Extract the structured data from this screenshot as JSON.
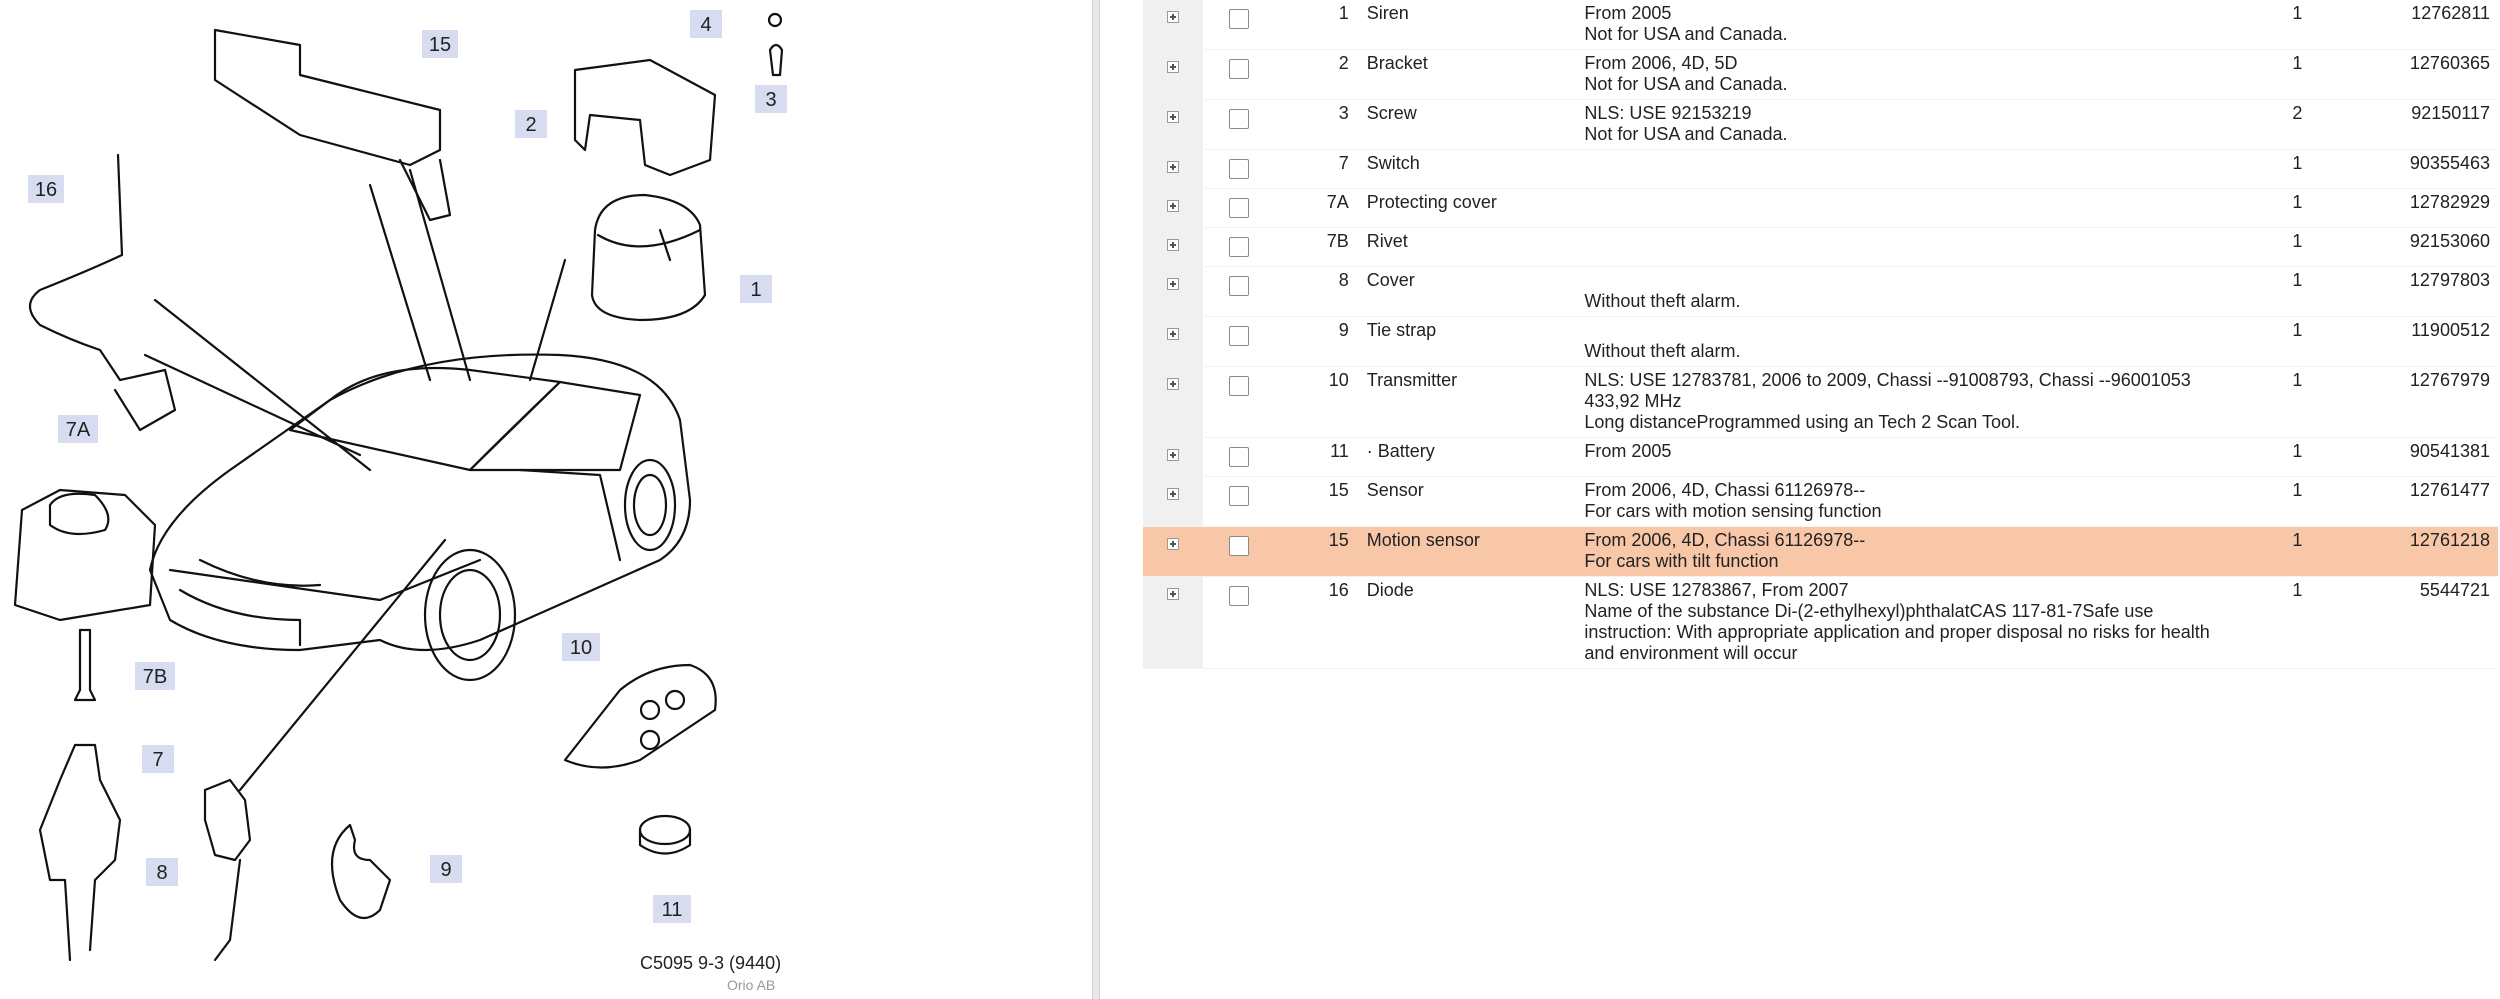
{
  "diagram": {
    "code": "C5095 9-3 (9440)",
    "copyright": "Orio AB",
    "callouts": [
      "15",
      "4",
      "3",
      "2",
      "1",
      "16",
      "7A",
      "7B",
      "7",
      "8",
      "9",
      "10",
      "11"
    ]
  },
  "parts": [
    {
      "pos": "1",
      "name": "Siren",
      "remark": [
        "From 2005",
        "Not for USA and Canada."
      ],
      "qty": "1",
      "partno": "12762811",
      "highlight": false
    },
    {
      "pos": "2",
      "name": "Bracket",
      "remark": [
        "From 2006, 4D, 5D",
        "Not for USA and Canada."
      ],
      "qty": "1",
      "partno": "12760365",
      "highlight": false
    },
    {
      "pos": "3",
      "name": "Screw",
      "remark": [
        "NLS: USE 92153219",
        "Not for USA and Canada."
      ],
      "qty": "2",
      "partno": "92150117",
      "highlight": false
    },
    {
      "pos": "7",
      "name": "Switch",
      "remark": [],
      "qty": "1",
      "partno": "90355463",
      "highlight": false
    },
    {
      "pos": "7A",
      "name": "Protecting cover",
      "remark": [],
      "qty": "1",
      "partno": "12782929",
      "highlight": false
    },
    {
      "pos": "7B",
      "name": "Rivet",
      "remark": [],
      "qty": "1",
      "partno": "92153060",
      "highlight": false
    },
    {
      "pos": "8",
      "name": "Cover",
      "remark": [
        "",
        "Without theft alarm."
      ],
      "qty": "1",
      "partno": "12797803",
      "highlight": false
    },
    {
      "pos": "9",
      "name": "Tie strap",
      "remark": [
        "",
        "Without theft alarm."
      ],
      "qty": "1",
      "partno": "11900512",
      "highlight": false
    },
    {
      "pos": "10",
      "name": "Transmitter",
      "remark": [
        "NLS: USE 12783781, 2006 to 2009, Chassi --91008793, Chassi --96001053",
        "433,92 MHz",
        "Long distanceProgrammed using an Tech 2 Scan Tool."
      ],
      "qty": "1",
      "partno": "12767979",
      "highlight": false
    },
    {
      "pos": "11",
      "name": "· Battery",
      "remark": [
        "From 2005"
      ],
      "qty": "1",
      "partno": "90541381",
      "highlight": false
    },
    {
      "pos": "15",
      "name": "Sensor",
      "remark": [
        "From 2006, 4D, Chassi 61126978--",
        "For cars with motion sensing function"
      ],
      "qty": "1",
      "partno": "12761477",
      "highlight": false
    },
    {
      "pos": "15",
      "name": "Motion sensor",
      "remark": [
        "From 2006, 4D, Chassi 61126978--",
        "For cars with tilt function"
      ],
      "qty": "1",
      "partno": "12761218",
      "highlight": true
    },
    {
      "pos": "16",
      "name": "Diode",
      "remark": [
        "NLS: USE 12783867, From 2007",
        "Name of the substance Di-(2-ethylhexyl)phthalatCAS 117-81-7Safe use",
        "instruction: With appropriate application and proper disposal no risks for health",
        "and environment will occur"
      ],
      "qty": "1",
      "partno": "5544721",
      "highlight": false
    }
  ]
}
